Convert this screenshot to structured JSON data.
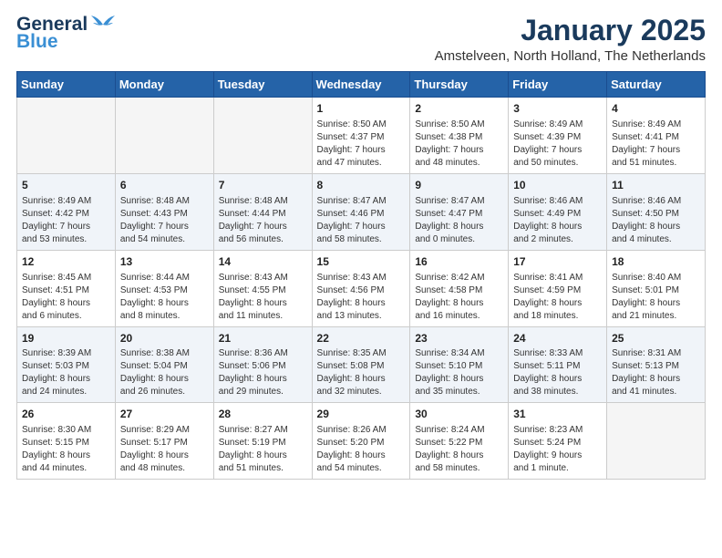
{
  "logo": {
    "line1": "General",
    "line2": "Blue"
  },
  "header": {
    "title": "January 2025",
    "subtitle": "Amstelveen, North Holland, The Netherlands"
  },
  "weekdays": [
    "Sunday",
    "Monday",
    "Tuesday",
    "Wednesday",
    "Thursday",
    "Friday",
    "Saturday"
  ],
  "weeks": [
    [
      {
        "day": "",
        "info": ""
      },
      {
        "day": "",
        "info": ""
      },
      {
        "day": "",
        "info": ""
      },
      {
        "day": "1",
        "info": "Sunrise: 8:50 AM\nSunset: 4:37 PM\nDaylight: 7 hours\nand 47 minutes."
      },
      {
        "day": "2",
        "info": "Sunrise: 8:50 AM\nSunset: 4:38 PM\nDaylight: 7 hours\nand 48 minutes."
      },
      {
        "day": "3",
        "info": "Sunrise: 8:49 AM\nSunset: 4:39 PM\nDaylight: 7 hours\nand 50 minutes."
      },
      {
        "day": "4",
        "info": "Sunrise: 8:49 AM\nSunset: 4:41 PM\nDaylight: 7 hours\nand 51 minutes."
      }
    ],
    [
      {
        "day": "5",
        "info": "Sunrise: 8:49 AM\nSunset: 4:42 PM\nDaylight: 7 hours\nand 53 minutes."
      },
      {
        "day": "6",
        "info": "Sunrise: 8:48 AM\nSunset: 4:43 PM\nDaylight: 7 hours\nand 54 minutes."
      },
      {
        "day": "7",
        "info": "Sunrise: 8:48 AM\nSunset: 4:44 PM\nDaylight: 7 hours\nand 56 minutes."
      },
      {
        "day": "8",
        "info": "Sunrise: 8:47 AM\nSunset: 4:46 PM\nDaylight: 7 hours\nand 58 minutes."
      },
      {
        "day": "9",
        "info": "Sunrise: 8:47 AM\nSunset: 4:47 PM\nDaylight: 8 hours\nand 0 minutes."
      },
      {
        "day": "10",
        "info": "Sunrise: 8:46 AM\nSunset: 4:49 PM\nDaylight: 8 hours\nand 2 minutes."
      },
      {
        "day": "11",
        "info": "Sunrise: 8:46 AM\nSunset: 4:50 PM\nDaylight: 8 hours\nand 4 minutes."
      }
    ],
    [
      {
        "day": "12",
        "info": "Sunrise: 8:45 AM\nSunset: 4:51 PM\nDaylight: 8 hours\nand 6 minutes."
      },
      {
        "day": "13",
        "info": "Sunrise: 8:44 AM\nSunset: 4:53 PM\nDaylight: 8 hours\nand 8 minutes."
      },
      {
        "day": "14",
        "info": "Sunrise: 8:43 AM\nSunset: 4:55 PM\nDaylight: 8 hours\nand 11 minutes."
      },
      {
        "day": "15",
        "info": "Sunrise: 8:43 AM\nSunset: 4:56 PM\nDaylight: 8 hours\nand 13 minutes."
      },
      {
        "day": "16",
        "info": "Sunrise: 8:42 AM\nSunset: 4:58 PM\nDaylight: 8 hours\nand 16 minutes."
      },
      {
        "day": "17",
        "info": "Sunrise: 8:41 AM\nSunset: 4:59 PM\nDaylight: 8 hours\nand 18 minutes."
      },
      {
        "day": "18",
        "info": "Sunrise: 8:40 AM\nSunset: 5:01 PM\nDaylight: 8 hours\nand 21 minutes."
      }
    ],
    [
      {
        "day": "19",
        "info": "Sunrise: 8:39 AM\nSunset: 5:03 PM\nDaylight: 8 hours\nand 24 minutes."
      },
      {
        "day": "20",
        "info": "Sunrise: 8:38 AM\nSunset: 5:04 PM\nDaylight: 8 hours\nand 26 minutes."
      },
      {
        "day": "21",
        "info": "Sunrise: 8:36 AM\nSunset: 5:06 PM\nDaylight: 8 hours\nand 29 minutes."
      },
      {
        "day": "22",
        "info": "Sunrise: 8:35 AM\nSunset: 5:08 PM\nDaylight: 8 hours\nand 32 minutes."
      },
      {
        "day": "23",
        "info": "Sunrise: 8:34 AM\nSunset: 5:10 PM\nDaylight: 8 hours\nand 35 minutes."
      },
      {
        "day": "24",
        "info": "Sunrise: 8:33 AM\nSunset: 5:11 PM\nDaylight: 8 hours\nand 38 minutes."
      },
      {
        "day": "25",
        "info": "Sunrise: 8:31 AM\nSunset: 5:13 PM\nDaylight: 8 hours\nand 41 minutes."
      }
    ],
    [
      {
        "day": "26",
        "info": "Sunrise: 8:30 AM\nSunset: 5:15 PM\nDaylight: 8 hours\nand 44 minutes."
      },
      {
        "day": "27",
        "info": "Sunrise: 8:29 AM\nSunset: 5:17 PM\nDaylight: 8 hours\nand 48 minutes."
      },
      {
        "day": "28",
        "info": "Sunrise: 8:27 AM\nSunset: 5:19 PM\nDaylight: 8 hours\nand 51 minutes."
      },
      {
        "day": "29",
        "info": "Sunrise: 8:26 AM\nSunset: 5:20 PM\nDaylight: 8 hours\nand 54 minutes."
      },
      {
        "day": "30",
        "info": "Sunrise: 8:24 AM\nSunset: 5:22 PM\nDaylight: 8 hours\nand 58 minutes."
      },
      {
        "day": "31",
        "info": "Sunrise: 8:23 AM\nSunset: 5:24 PM\nDaylight: 9 hours\nand 1 minute."
      },
      {
        "day": "",
        "info": ""
      }
    ]
  ]
}
